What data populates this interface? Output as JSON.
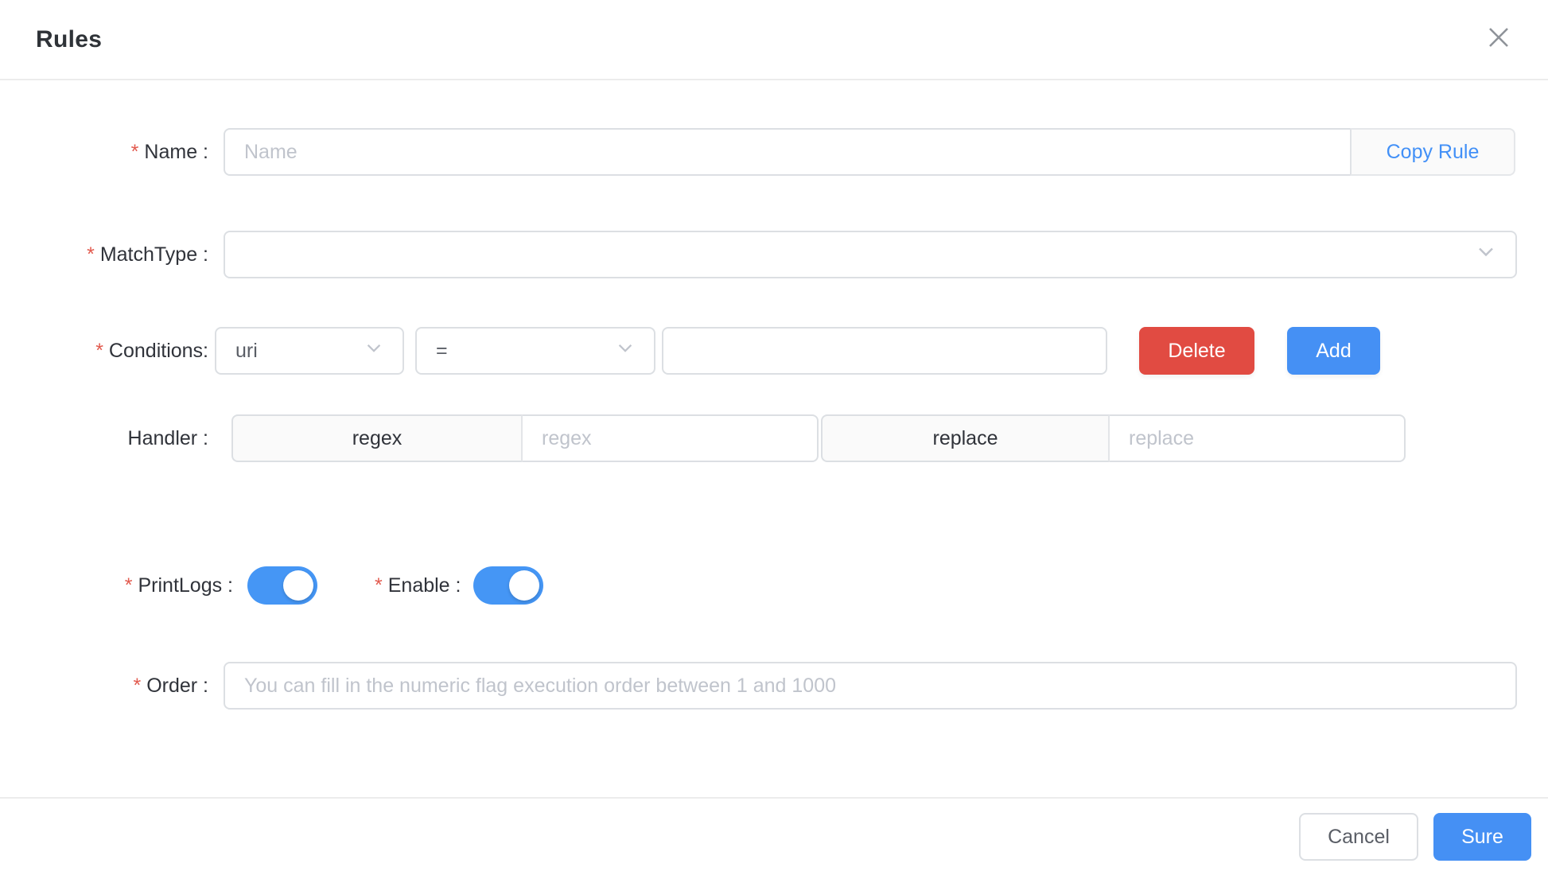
{
  "dialog": {
    "title": "Rules"
  },
  "colors": {
    "primary_blue": "#4590f4",
    "danger_red": "#e14b42",
    "link_blue": "#4290f7",
    "toggle_on_blue": "#4596f5",
    "required_asterisk_red": "#e25a4e",
    "divider_gray": "#ececec",
    "addon_bg": "#fafafa"
  },
  "form": {
    "required_mark": "*",
    "name": {
      "label": "Name :",
      "required": true,
      "value": "",
      "placeholder": "Name",
      "copy_button": "Copy Rule"
    },
    "match_type": {
      "label": "MatchType :",
      "required": true,
      "selected_value": ""
    },
    "conditions": {
      "label": "Conditions:",
      "required": true,
      "field_select": "uri",
      "operator_select": "=",
      "value": "",
      "delete_button": "Delete",
      "add_button": "Add"
    },
    "handler": {
      "label": "Handler :",
      "required": false,
      "groups": [
        {
          "addon": "regex",
          "value": "",
          "placeholder": "regex"
        },
        {
          "addon": "replace",
          "value": "",
          "placeholder": "replace"
        }
      ]
    },
    "print_logs": {
      "label": "PrintLogs :",
      "required": true,
      "state": "on"
    },
    "enable": {
      "label": "Enable :",
      "required": true,
      "state": "on"
    },
    "order": {
      "label": "Order :",
      "required": true,
      "value": "",
      "placeholder": "You can fill in the numeric flag execution order between 1 and 1000"
    }
  },
  "footer": {
    "cancel_label": "Cancel",
    "sure_label": "Sure"
  }
}
